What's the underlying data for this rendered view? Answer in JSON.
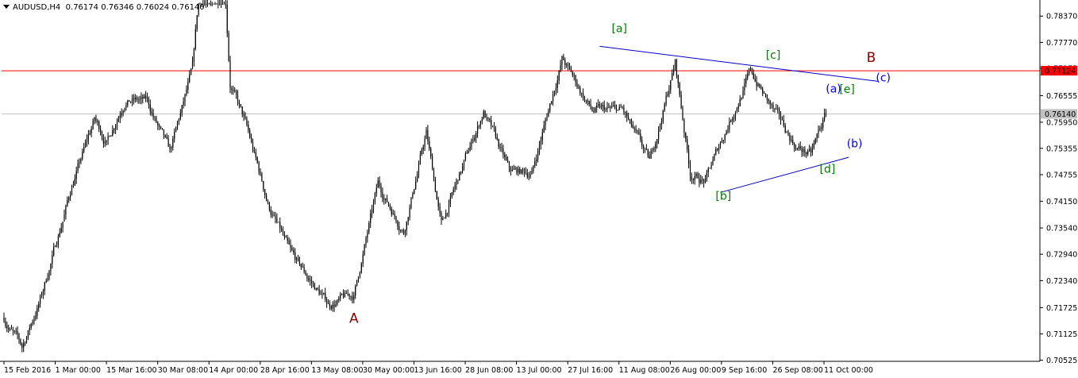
{
  "header": {
    "symbol": "AUDUSD,H4",
    "open": "0.76174",
    "high": "0.76346",
    "low": "0.76024",
    "close": "0.76140"
  },
  "colors": {
    "candle": "#000000",
    "grid": "#c0c0c0",
    "resistance_line": "#ff0000",
    "price_line": "#c0c0c0",
    "trend_lines": "#0000cc",
    "label_green": "#008000",
    "label_blue": "#0000ff",
    "label_darkred": "#8b0000",
    "price_tag_red": "#ff0000",
    "price_tag_gray": "#c0c0c0"
  },
  "chart_data": {
    "type": "candlestick",
    "title": "AUDUSD,H4",
    "ylim": [
      0.705,
      0.787
    ],
    "yticks": [
      "0.78370",
      "0.77770",
      "0.77175",
      "0.76555",
      "0.75950",
      "0.75355",
      "0.74755",
      "0.74150",
      "0.73540",
      "0.72940",
      "0.72340",
      "0.71725",
      "0.71125",
      "0.70525"
    ],
    "ytick_values": [
      0.7837,
      0.7777,
      0.77175,
      0.76555,
      0.7595,
      0.75355,
      0.74755,
      0.7415,
      0.7354,
      0.7294,
      0.7234,
      0.71725,
      0.71125,
      0.70525
    ],
    "xticks": [
      "15 Feb 2016",
      "1 Mar 00:00",
      "15 Mar 16:00",
      "30 Mar 08:00",
      "14 Apr 00:00",
      "28 Apr 16:00",
      "13 May 08:00",
      "30 May 00:00",
      "13 Jun 16:00",
      "28 Jun 08:00",
      "13 Jul 00:00",
      "27 Jul 16:00",
      "11 Aug 08:00",
      "26 Aug 00:00",
      "9 Sep 16:00",
      "26 Sep 08:00",
      "11 Oct 00:00"
    ],
    "bar_count": 650,
    "close_anchors": [
      {
        "bar": 0,
        "close": 0.715
      },
      {
        "bar": 12,
        "close": 0.708
      },
      {
        "bar": 25,
        "close": 0.72
      },
      {
        "bar": 45,
        "close": 0.745
      },
      {
        "bar": 60,
        "close": 0.76
      },
      {
        "bar": 68,
        "close": 0.755
      },
      {
        "bar": 80,
        "close": 0.765
      },
      {
        "bar": 95,
        "close": 0.764
      },
      {
        "bar": 110,
        "close": 0.752
      },
      {
        "bar": 125,
        "close": 0.771
      },
      {
        "bar": 140,
        "close": 0.832
      },
      {
        "bar": 150,
        "close": 0.769
      },
      {
        "bar": 160,
        "close": 0.759
      },
      {
        "bar": 175,
        "close": 0.741
      },
      {
        "bar": 190,
        "close": 0.729
      },
      {
        "bar": 215,
        "close": 0.718
      },
      {
        "bar": 232,
        "close": 0.72
      },
      {
        "bar": 248,
        "close": 0.745
      },
      {
        "bar": 265,
        "close": 0.735
      },
      {
        "bar": 280,
        "close": 0.757
      },
      {
        "bar": 290,
        "close": 0.736
      },
      {
        "bar": 305,
        "close": 0.75
      },
      {
        "bar": 318,
        "close": 0.762
      },
      {
        "bar": 335,
        "close": 0.748
      },
      {
        "bar": 350,
        "close": 0.748
      },
      {
        "bar": 370,
        "close": 0.774
      },
      {
        "bar": 390,
        "close": 0.762
      },
      {
        "bar": 410,
        "close": 0.762
      },
      {
        "bar": 428,
        "close": 0.75
      },
      {
        "bar": 445,
        "close": 0.773
      },
      {
        "bar": 455,
        "close": 0.748
      },
      {
        "bar": 465,
        "close": 0.746
      },
      {
        "bar": 480,
        "close": 0.759
      },
      {
        "bar": 495,
        "close": 0.771
      },
      {
        "bar": 510,
        "close": 0.762
      },
      {
        "bar": 525,
        "close": 0.754
      },
      {
        "bar": 535,
        "close": 0.752
      },
      {
        "bar": 545,
        "close": 0.7614
      }
    ],
    "series": [
      {
        "type": "hline",
        "value": 0.77124,
        "tag": "0.77124"
      },
      {
        "type": "hline",
        "value": 0.7614,
        "tag": "0.76140"
      }
    ],
    "trendlines": [
      {
        "from": {
          "bar": 395,
          "price": 0.7768
        },
        "to": {
          "bar": 580,
          "price": 0.7688
        }
      },
      {
        "from": {
          "bar": 475,
          "price": 0.7435
        },
        "to": {
          "bar": 560,
          "price": 0.7515
        }
      }
    ],
    "wave_labels": [
      {
        "text": "A",
        "bar": 232,
        "price": 0.7138,
        "color": "darkred"
      },
      {
        "text": "[a]",
        "bar": 408,
        "price": 0.78,
        "color": "green"
      },
      {
        "text": "[b]",
        "bar": 477,
        "price": 0.7418,
        "color": "green"
      },
      {
        "text": "[c]",
        "bar": 510,
        "price": 0.774,
        "color": "green"
      },
      {
        "text": "[d]",
        "bar": 546,
        "price": 0.748,
        "color": "green"
      },
      {
        "text": "[e]",
        "bar": 559,
        "price": 0.7662,
        "color": "green"
      },
      {
        "text": "(a)",
        "bar": 550,
        "price": 0.7663,
        "color": "blue"
      },
      {
        "text": "(b)",
        "bar": 564,
        "price": 0.7538,
        "color": "blue"
      },
      {
        "text": "(c)",
        "bar": 583,
        "price": 0.7688,
        "color": "blue"
      },
      {
        "text": "B",
        "bar": 575,
        "price": 0.7732,
        "color": "darkred"
      }
    ]
  }
}
